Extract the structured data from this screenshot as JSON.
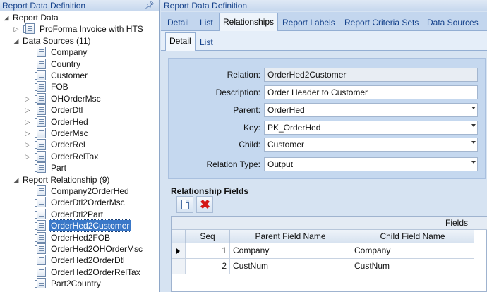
{
  "left_pane": {
    "title": "Report Data Definition",
    "tree": [
      {
        "label": "Report Data",
        "level": 0,
        "expander": "open",
        "icon": false
      },
      {
        "label": "ProForma Invoice with HTS",
        "level": 1,
        "expander": "closed",
        "icon": true
      },
      {
        "label": "Data Sources (11)",
        "level": 1,
        "expander": "open",
        "icon": false
      },
      {
        "label": "Company",
        "level": 2,
        "expander": "none",
        "icon": true
      },
      {
        "label": "Country",
        "level": 2,
        "expander": "none",
        "icon": true
      },
      {
        "label": "Customer",
        "level": 2,
        "expander": "none",
        "icon": true
      },
      {
        "label": "FOB",
        "level": 2,
        "expander": "none",
        "icon": true
      },
      {
        "label": "OHOrderMsc",
        "level": 2,
        "expander": "closed",
        "icon": true
      },
      {
        "label": "OrderDtl",
        "level": 2,
        "expander": "closed",
        "icon": true
      },
      {
        "label": "OrderHed",
        "level": 2,
        "expander": "closed",
        "icon": true
      },
      {
        "label": "OrderMsc",
        "level": 2,
        "expander": "closed",
        "icon": true
      },
      {
        "label": "OrderRel",
        "level": 2,
        "expander": "closed",
        "icon": true
      },
      {
        "label": "OrderRelTax",
        "level": 2,
        "expander": "closed",
        "icon": true
      },
      {
        "label": "Part",
        "level": 2,
        "expander": "none",
        "icon": true
      },
      {
        "label": "Report Relationship (9)",
        "level": 1,
        "expander": "open",
        "icon": false
      },
      {
        "label": "Company2OrderHed",
        "level": 2,
        "expander": "none",
        "icon": true
      },
      {
        "label": "OrderDtl2OrderMsc",
        "level": 2,
        "expander": "none",
        "icon": true
      },
      {
        "label": "OrderDtl2Part",
        "level": 2,
        "expander": "none",
        "icon": true
      },
      {
        "label": "OrderHed2Customer",
        "level": 2,
        "expander": "none",
        "icon": true,
        "selected": true
      },
      {
        "label": "OrderHed2FOB",
        "level": 2,
        "expander": "none",
        "icon": true
      },
      {
        "label": "OrderHed2OHOrderMsc",
        "level": 2,
        "expander": "none",
        "icon": true
      },
      {
        "label": "OrderHed2OrderDtl",
        "level": 2,
        "expander": "none",
        "icon": true
      },
      {
        "label": "OrderHed2OrderRelTax",
        "level": 2,
        "expander": "none",
        "icon": true
      },
      {
        "label": "Part2Country",
        "level": 2,
        "expander": "none",
        "icon": true
      }
    ]
  },
  "right_pane": {
    "title": "Report Data Definition",
    "tabs": [
      "Detail",
      "List",
      "Relationships",
      "Report Labels",
      "Report Criteria Sets",
      "Data Sources"
    ],
    "active_tab": "Relationships",
    "subtabs": [
      "Detail",
      "List"
    ],
    "active_subtab": "Detail",
    "form": {
      "relation_label": "Relation:",
      "relation_value": "OrderHed2Customer",
      "description_label": "Description:",
      "description_value": "Order Header to Customer",
      "parent_label": "Parent:",
      "parent_value": "OrderHed",
      "key_label": "Key:",
      "key_value": "PK_OrderHed",
      "child_label": "Child:",
      "child_value": "Customer",
      "relation_type_label": "Relation Type:",
      "relation_type_value": "Output"
    },
    "relationship_fields": {
      "title": "Relationship Fields",
      "toolbar_icons": [
        "new-document-icon",
        "delete-x-icon"
      ],
      "group_header": "Fields",
      "columns": [
        "Seq",
        "Parent Field Name",
        "Child Field Name"
      ],
      "rows": [
        {
          "seq": "1",
          "parent": "Company",
          "child": "Company",
          "current": true
        },
        {
          "seq": "2",
          "parent": "CustNum",
          "child": "CustNum",
          "current": false
        }
      ]
    }
  },
  "colors": {
    "selection": "#3a78c8",
    "accent_text": "#15428b",
    "delete_icon": "#d41717"
  }
}
